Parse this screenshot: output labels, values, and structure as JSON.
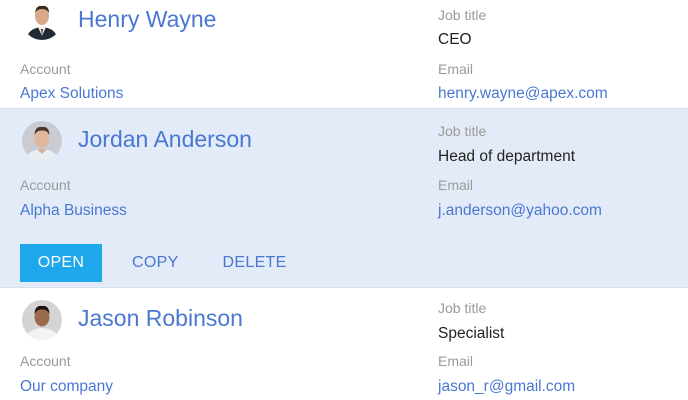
{
  "contacts": [
    {
      "name": "Henry Wayne",
      "avatar_icon": "person-photo-suit",
      "job_title_caption": "Job title",
      "job_title": "CEO",
      "account_caption": "Account",
      "account": "Apex Solutions",
      "email_caption": "Email",
      "email": "henry.wayne@apex.com"
    },
    {
      "name": "Jordan Anderson",
      "avatar_icon": "person-photo-shirt",
      "job_title_caption": "Job title",
      "job_title": "Head of department",
      "account_caption": "Account",
      "account": "Alpha Business",
      "email_caption": "Email",
      "email": "j.anderson@yahoo.com",
      "selected": true
    },
    {
      "name": "Jason Robinson",
      "avatar_icon": "person-photo-dark",
      "job_title_caption": "Job title",
      "job_title": "Specialist",
      "account_caption": "Account",
      "account": "Our company",
      "email_caption": "Email",
      "email": "jason_r@gmail.com"
    }
  ],
  "actions": {
    "open_label": "OPEN",
    "copy_label": "COPY",
    "delete_label": "DELETE"
  },
  "colors": {
    "link": "#4a78d1",
    "selected_row_bg": "#e3ebf8",
    "primary_button": "#1ea7ea",
    "caption": "#9a9a9a"
  }
}
